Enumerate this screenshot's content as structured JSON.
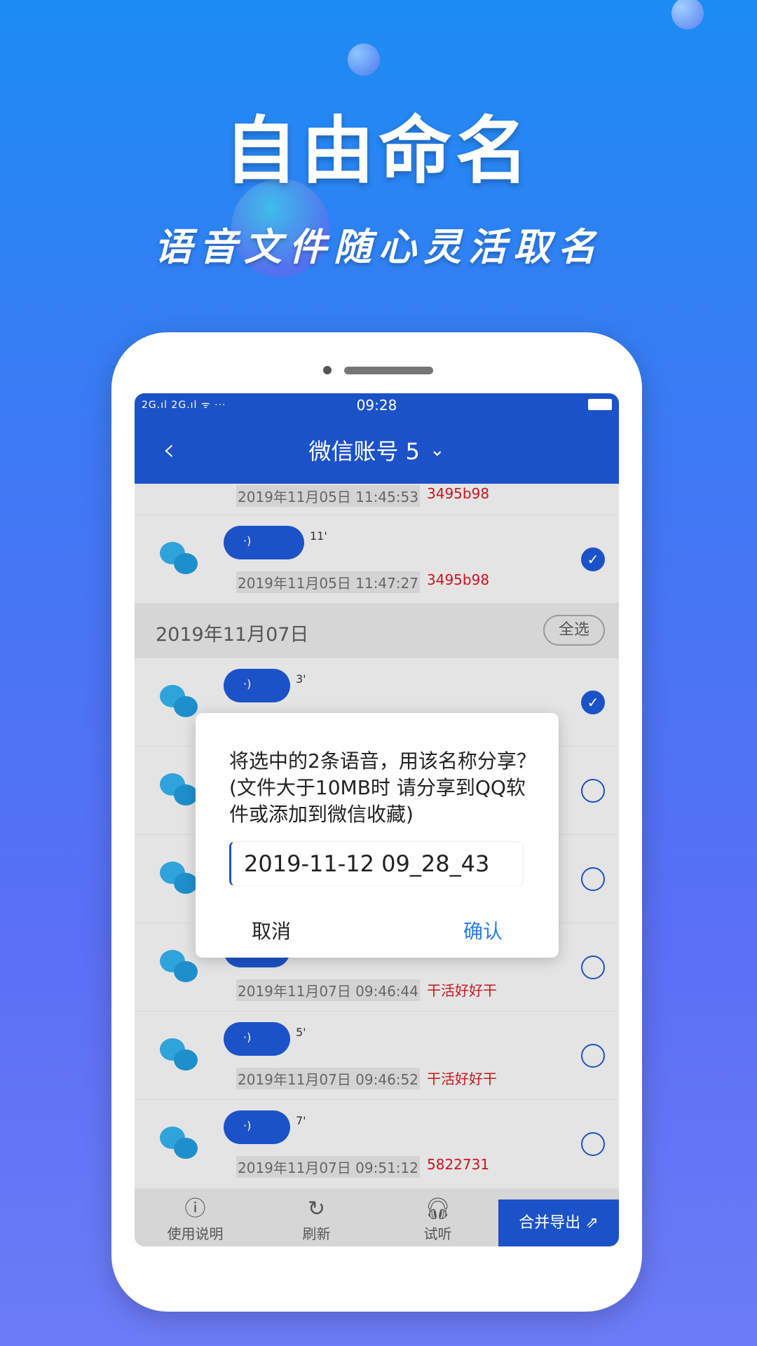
{
  "hero": {
    "title": "自由命名",
    "subtitle": "语音文件随心灵活取名"
  },
  "status_bar": {
    "signal": "2G.ıl 2G.ıl ᯤ ···",
    "time": "09:28"
  },
  "nav": {
    "back_icon": "chevron-left-icon",
    "title": "微信账号 5",
    "dropdown_icon": "chevron-down-icon"
  },
  "partial_row": {
    "timestamp": "2019年11月05日 11:45:53",
    "tag": "3495b98"
  },
  "rows_a": [
    {
      "duration": "11'",
      "timestamp": "2019年11月05日 11:47:27",
      "tag": "3495b98",
      "checked": true
    }
  ],
  "date_header": {
    "date": "2019年11月07日",
    "select_all": "全选"
  },
  "rows_b": [
    {
      "duration": "3'",
      "timestamp": "",
      "tag": "",
      "checked": true
    },
    {
      "duration": "",
      "timestamp": "",
      "tag": "",
      "checked": false
    },
    {
      "duration": "",
      "timestamp": "",
      "tag": "",
      "checked": false
    },
    {
      "duration": "",
      "timestamp": "2019年11月07日 09:46:44",
      "tag": "干活好好干",
      "checked": false
    },
    {
      "duration": "5'",
      "timestamp": "2019年11月07日 09:46:52",
      "tag": "干活好好干",
      "checked": false
    },
    {
      "duration": "7'",
      "timestamp": "2019年11月07日 09:51:12",
      "tag": "5822731",
      "checked": false
    }
  ],
  "voice_icon": "·)",
  "bottom_bar": {
    "help": "使用说明",
    "refresh": "刷新",
    "listen": "试听",
    "export": "合并导出"
  },
  "dialog": {
    "message": "将选中的2条语音，用该名称分享？(文件大于10MB时 请分享到QQ软件或添加到微信收藏)",
    "input_value": "2019-11-12 09_28_43",
    "cancel": "取消",
    "confirm": "确认"
  },
  "colors": {
    "primary": "#1c52c7",
    "tag": "#c8141e",
    "confirm": "#2a7de1"
  }
}
